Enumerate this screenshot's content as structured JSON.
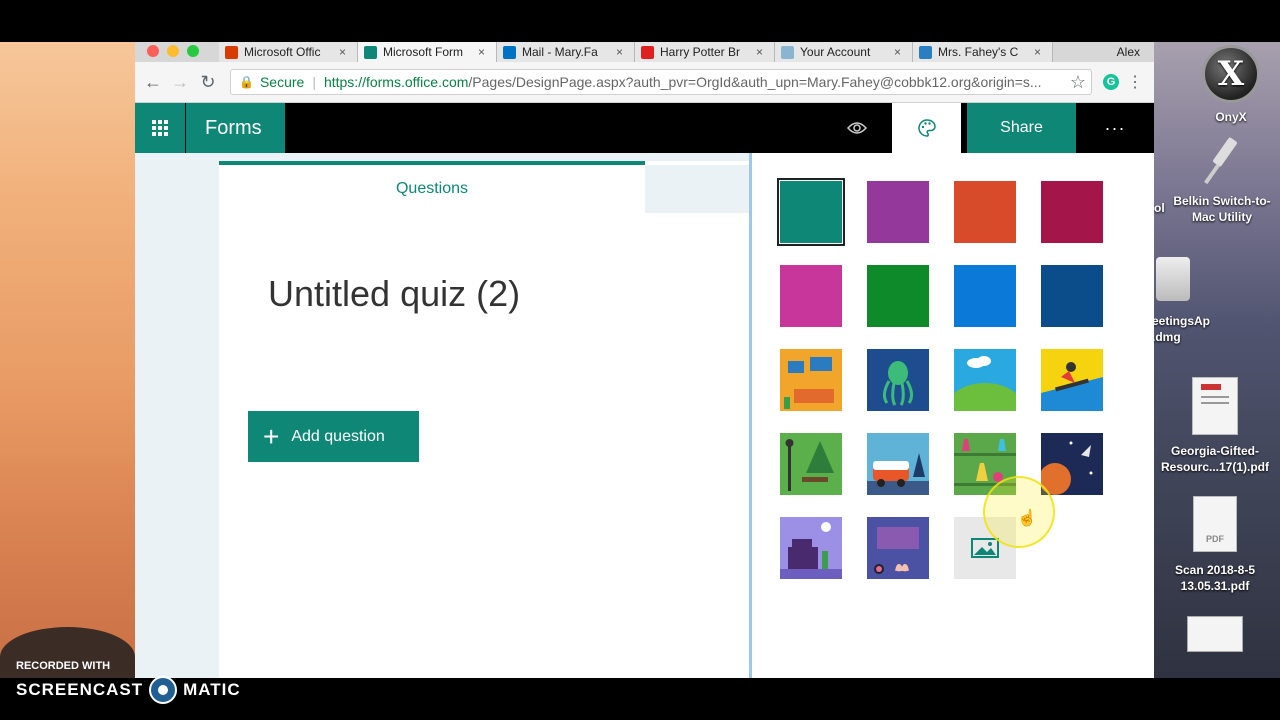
{
  "browser": {
    "tabs": [
      {
        "title": "Microsoft Offic",
        "icon": "office-icon",
        "color": "#d83b01",
        "active": false
      },
      {
        "title": "Microsoft Form",
        "icon": "forms-icon",
        "color": "#0f8777",
        "active": true
      },
      {
        "title": "Mail - Mary.Fa",
        "icon": "outlook-icon",
        "color": "#0072c6",
        "active": false
      },
      {
        "title": "Harry Potter Br",
        "icon": "t-icon",
        "color": "#e02020",
        "active": false
      },
      {
        "title": "Your Account",
        "icon": "account-icon",
        "color": "#8ab4d0",
        "active": false
      },
      {
        "title": "Mrs. Fahey's C",
        "icon": "edublog-icon",
        "color": "#2a7fc1",
        "active": false
      }
    ],
    "profile": "Alex",
    "secure_label": "Secure",
    "url_host": "https://forms.office.com",
    "url_path": "/Pages/DesignPage.aspx?auth_pvr=OrgId&auth_upn=Mary.Fahey@cobbk12.org&origin=s..."
  },
  "forms": {
    "app_name": "Forms",
    "share_label": "Share",
    "more_label": "···",
    "tab_questions": "Questions",
    "quiz_title": "Untitled quiz (2)",
    "add_question_label": "Add question"
  },
  "themes": {
    "selected": 0,
    "items": [
      {
        "name": "teal",
        "color": "#0f8777"
      },
      {
        "name": "purple",
        "color": "#94389c"
      },
      {
        "name": "orange",
        "color": "#d84b2a"
      },
      {
        "name": "crimson",
        "color": "#a4164a"
      },
      {
        "name": "magenta",
        "color": "#c8369b"
      },
      {
        "name": "green",
        "color": "#0f8a2a"
      },
      {
        "name": "blue",
        "color": "#0b79d8"
      },
      {
        "name": "navy",
        "color": "#0b4c8a"
      },
      {
        "name": "living-room",
        "color": "#f2a52b"
      },
      {
        "name": "octopus",
        "color": "#1d4d8f"
      },
      {
        "name": "hills",
        "color": "#2aa8e0"
      },
      {
        "name": "snowboarder",
        "color": "#f5d40f"
      },
      {
        "name": "park",
        "color": "#5bb04b"
      },
      {
        "name": "camper-van",
        "color": "#5fb3d6"
      },
      {
        "name": "lab-flasks",
        "color": "#5aa84a"
      },
      {
        "name": "space",
        "color": "#1c2a55"
      },
      {
        "name": "desk",
        "color": "#9b8fe6"
      },
      {
        "name": "keyboard",
        "color": "#4b52a3"
      },
      {
        "name": "upload-image",
        "color": "#e8e8e8"
      }
    ]
  },
  "desktop": {
    "icons": [
      {
        "label": "OnyX"
      },
      {
        "label": "Belkin Switch-to-Mac Utility"
      },
      {
        "label": "eetingsAp .dmg"
      },
      {
        "label": "Georgia-Gifted-Resourc...17(1).pdf"
      },
      {
        "label": "Scan 2018-8-5 13.05.31.pdf"
      }
    ],
    "fragment_label": "ol"
  },
  "watermark": {
    "line1": "RECORDED WITH",
    "word1": "SCREENCAST",
    "word2": "MATIC"
  }
}
